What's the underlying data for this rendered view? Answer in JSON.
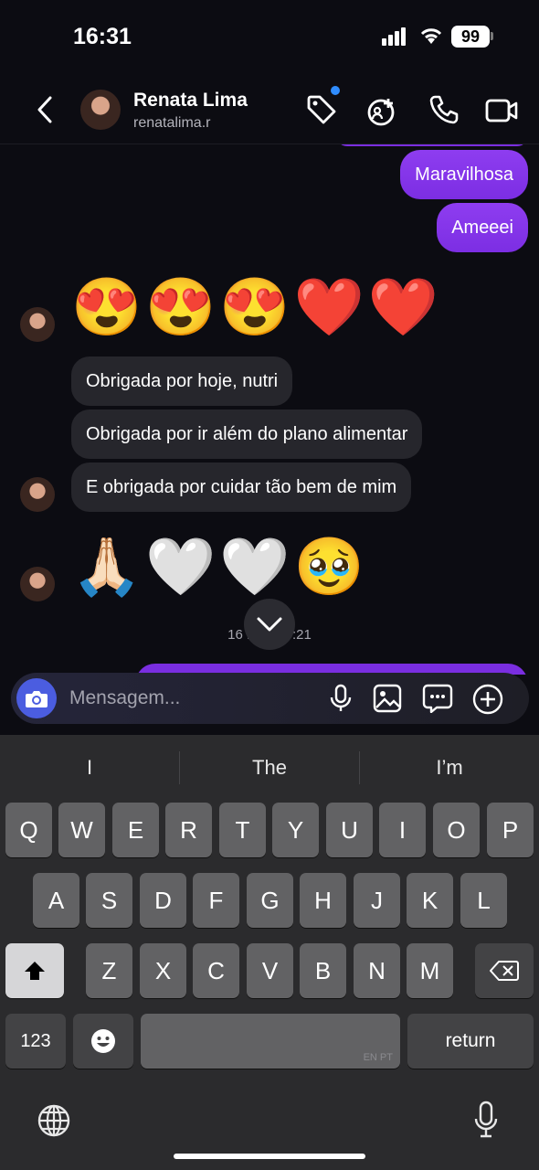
{
  "status": {
    "time": "16:31",
    "battery": "99"
  },
  "header": {
    "name": "Renata Lima",
    "handle": "renatalima.r"
  },
  "messages": {
    "out1": "Maravilhosa",
    "out2": "Ameeei",
    "emoji1": "😍😍😍❤️❤️",
    "in1": "Obrigada por hoje, nutri",
    "in2": "Obrigada por ir além do plano alimentar",
    "in3": "E obrigada por cuidar tão bem de mim",
    "emoji2": "🙏🏻🤍🤍🥹",
    "timestamp": "16 DE    , 15:21"
  },
  "composer": {
    "placeholder": "Mensagem..."
  },
  "keyboard": {
    "suggestions": [
      "I",
      "The",
      "I’m"
    ],
    "row1": [
      "Q",
      "W",
      "E",
      "R",
      "T",
      "Y",
      "U",
      "I",
      "O",
      "P"
    ],
    "row2": [
      "A",
      "S",
      "D",
      "F",
      "G",
      "H",
      "J",
      "K",
      "L"
    ],
    "row3": [
      "Z",
      "X",
      "C",
      "V",
      "B",
      "N",
      "M"
    ],
    "numbers": "123",
    "space_lang": "EN PT",
    "return": "return"
  },
  "colors": {
    "outgoing": "#8e3df0",
    "incoming": "#26262c",
    "camera": "#4b5de0",
    "notification_dot": "#2f8cff"
  },
  "icons": [
    "chevron-left-icon",
    "tag-icon",
    "add-people-icon",
    "phone-icon",
    "video-icon",
    "chevron-down-icon",
    "camera-icon",
    "microphone-icon",
    "image-icon",
    "sticker-icon",
    "plus-circle-icon",
    "shift-icon",
    "backspace-icon",
    "emoji-icon",
    "globe-icon",
    "dictation-icon"
  ]
}
